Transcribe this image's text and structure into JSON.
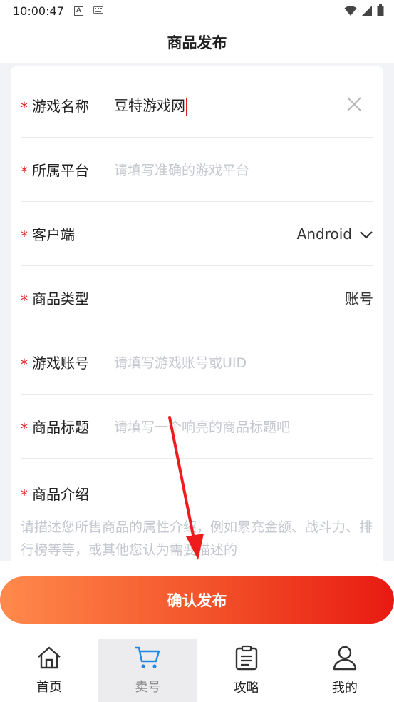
{
  "status_bar": {
    "time": "10:00:47",
    "ic_a": "A",
    "ic_keyboard": "keyboard-icon"
  },
  "header": {
    "title": "商品发布"
  },
  "form": {
    "required_mark": "*",
    "game_name": {
      "label": "游戏名称",
      "value": "豆特游戏网"
    },
    "platform": {
      "label": "所属平台",
      "placeholder": "请填写准确的游戏平台"
    },
    "client": {
      "label": "客户端",
      "value": "Android"
    },
    "product_type": {
      "label": "商品类型",
      "value": "账号"
    },
    "game_account": {
      "label": "游戏账号",
      "placeholder": "请填写游戏账号或UID"
    },
    "product_title": {
      "label": "商品标题",
      "placeholder": "请填写一个响亮的商品标题吧"
    },
    "product_intro": {
      "label": "商品介绍",
      "placeholder": "请描述您所售商品的属性介绍，例如累充金额、战斗力、排行榜等等，或其他您认为需要描述的"
    }
  },
  "confirm": {
    "label": "确认发布"
  },
  "colors": {
    "accent_start": "#ff8a4c",
    "accent_end": "#e81a12",
    "required": "#e02020",
    "annotation_arrow": "#ee1c1c"
  },
  "tabbar": {
    "items": [
      {
        "label": "首页",
        "icon": "home-icon"
      },
      {
        "label": "卖号",
        "icon": "cart-icon",
        "active": true
      },
      {
        "label": "攻略",
        "icon": "clipboard-icon"
      },
      {
        "label": "我的",
        "icon": "profile-icon"
      }
    ]
  }
}
